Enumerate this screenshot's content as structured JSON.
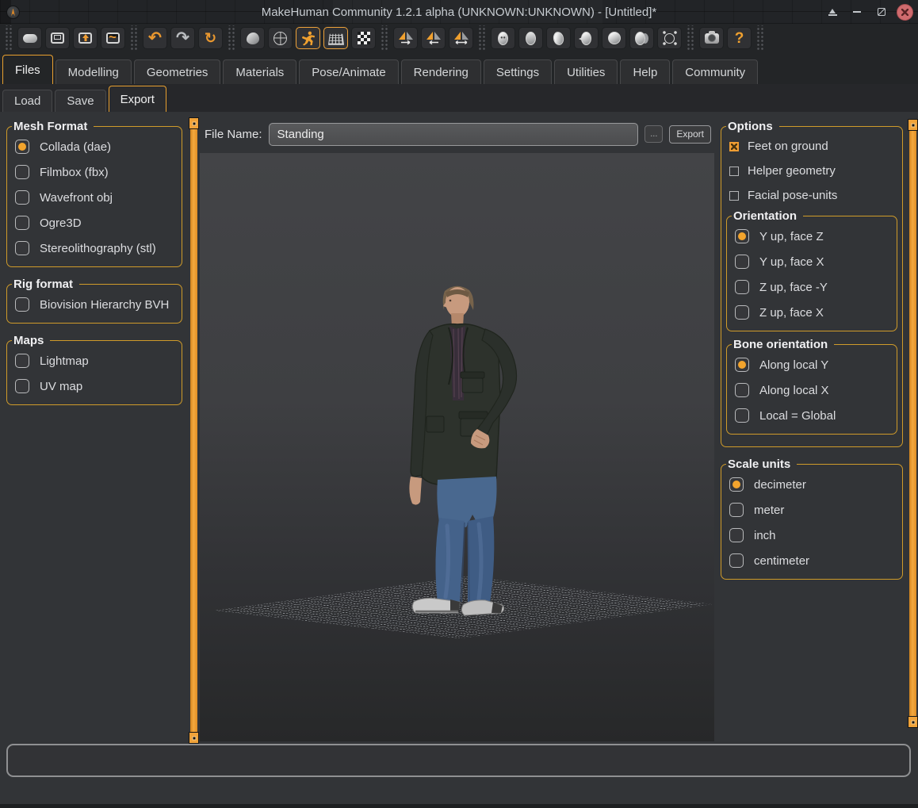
{
  "window": {
    "title": "MakeHuman Community 1.2.1 alpha (UNKNOWN:UNKNOWN) - [Untitled]*",
    "app_icon": "makehuman-logo",
    "controls": [
      "shade",
      "minimize",
      "maximize",
      "close"
    ]
  },
  "toolbar": {
    "groups": [
      [
        "file-new",
        "file-save",
        "file-load",
        "file-export"
      ],
      [
        "undo",
        "redo",
        "reset"
      ],
      [
        "smooth",
        "wireframe",
        "pose",
        "grid",
        "subdivide"
      ],
      [
        "symmetry-right",
        "symmetry-left",
        "symmetry-both"
      ],
      [
        "view-front",
        "view-back",
        "view-left",
        "view-right",
        "view-top",
        "view-side",
        "zoom-fit"
      ],
      [
        "grab-screen",
        "help"
      ]
    ],
    "active_buttons": [
      "pose",
      "grid"
    ]
  },
  "main_tabs": {
    "items": [
      "Files",
      "Modelling",
      "Geometries",
      "Materials",
      "Pose/Animate",
      "Rendering",
      "Settings",
      "Utilities",
      "Help",
      "Community"
    ],
    "active": "Files"
  },
  "sub_tabs": {
    "items": [
      "Load",
      "Save",
      "Export"
    ],
    "active": "Export"
  },
  "left_panel": {
    "mesh_format": {
      "title": "Mesh Format",
      "options": [
        "Collada (dae)",
        "Filmbox (fbx)",
        "Wavefront obj",
        "Ogre3D",
        "Stereolithography (stl)"
      ],
      "selected": "Collada (dae)"
    },
    "rig_format": {
      "title": "Rig format",
      "options": [
        "Biovision Hierarchy BVH"
      ],
      "checked": []
    },
    "maps": {
      "title": "Maps",
      "options": [
        "Lightmap",
        "UV map"
      ],
      "checked": []
    }
  },
  "file_bar": {
    "label": "File Name:",
    "filename": "Standing",
    "browse_button": "...",
    "export_button": "Export"
  },
  "viewport": {
    "content": "3D male character, short brown hair, dark jacket, blue jeans, white shoes, standing on wireframe grid floor"
  },
  "right_panel": {
    "options": {
      "title": "Options",
      "checkboxes": [
        {
          "label": "Feet on ground",
          "checked": true
        },
        {
          "label": "Helper geometry",
          "checked": false
        },
        {
          "label": "Facial pose-units",
          "checked": false
        }
      ]
    },
    "orientation": {
      "title": "Orientation",
      "options": [
        "Y up, face Z",
        "Y up, face X",
        "Z up, face -Y",
        "Z up, face X"
      ],
      "selected": "Y up, face Z"
    },
    "bone_orientation": {
      "title": "Bone orientation",
      "options": [
        "Along local Y",
        "Along local X",
        "Local = Global"
      ],
      "selected": "Along local Y"
    },
    "scale_units": {
      "title": "Scale units",
      "options": [
        "decimeter",
        "meter",
        "inch",
        "centimeter"
      ],
      "selected": "decimeter"
    }
  },
  "colors": {
    "accent_orange": "#efa02f",
    "group_border": "#cf9b2a",
    "splitter": "#f2a63d",
    "panel_bg": "#323437",
    "titlebar_bg": "#222427",
    "close_button": "#cf6b6e"
  }
}
